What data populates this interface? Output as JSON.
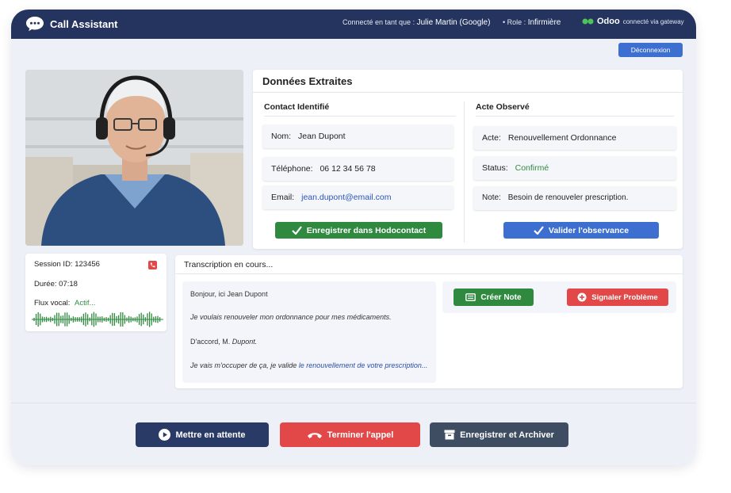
{
  "header": {
    "app_title": "Call Assistant",
    "connected_prefix": "Connecté en tant que :",
    "user_name": "Julie Martin (Google)",
    "role_prefix": "• Role :",
    "role_value": "Infirmière",
    "odoo_brand": "Odoo",
    "odoo_status": "connecté via gateway",
    "logout_label": "Déconnexion"
  },
  "extracted": {
    "title": "Données Extraites",
    "contact": {
      "title": "Contact Identifié",
      "name_label": "Nom:",
      "name_value": "Jean Dupont",
      "phone_label": "Téléphone:",
      "phone_value": "06 12 34 56 78",
      "email_label": "Email:",
      "email_value": "jean.dupont@email.com",
      "save_button": "Enregistrer dans Hodocontact"
    },
    "act": {
      "title": "Acte Observé",
      "act_label": "Acte:",
      "act_value": "Renouvellement Ordonnance",
      "status_label": "Status:",
      "status_value": "Confirmé",
      "note_label": "Note:",
      "note_value": "Besoin de renouveler prescription.",
      "validate_button": "Valider l'observance"
    }
  },
  "session": {
    "id_label": "Session ID:",
    "id_value": "123456",
    "duration_label": "Durée:",
    "duration_value": "07:18",
    "stream_label": "Flux vocal:",
    "stream_value": "Actif..."
  },
  "transcription": {
    "title": "Transcription en cours...",
    "l1": "Bonjour, ici Jean Dupont",
    "l2a": "Je voulais renouveler ",
    "l2b": "mon ordonnance pour mes médicaments.",
    "l3a": "D'accord, M. ",
    "l3b": "Dupont.",
    "l4a": "Je vais m'occuper de ça, je valide ",
    "l4b": "le renouvellement de votre prescription...",
    "create_note": "Créer Note",
    "report_problem": "Signaler Problème"
  },
  "footer": {
    "hold": "Mettre en attente",
    "end_call": "Terminer l'appel",
    "save_archive": "Enregistrer et Archiver"
  },
  "colors": {
    "navy": "#24345f",
    "green": "#2f8a3f",
    "blue": "#3c6fd0",
    "red": "#e24848",
    "slate": "#3f4d63"
  },
  "icons": [
    "chat-bubble-icon",
    "phone-icon",
    "checkmark-icon",
    "note-icon",
    "plus-circle-icon",
    "play-icon",
    "hangup-icon",
    "archive-icon"
  ]
}
